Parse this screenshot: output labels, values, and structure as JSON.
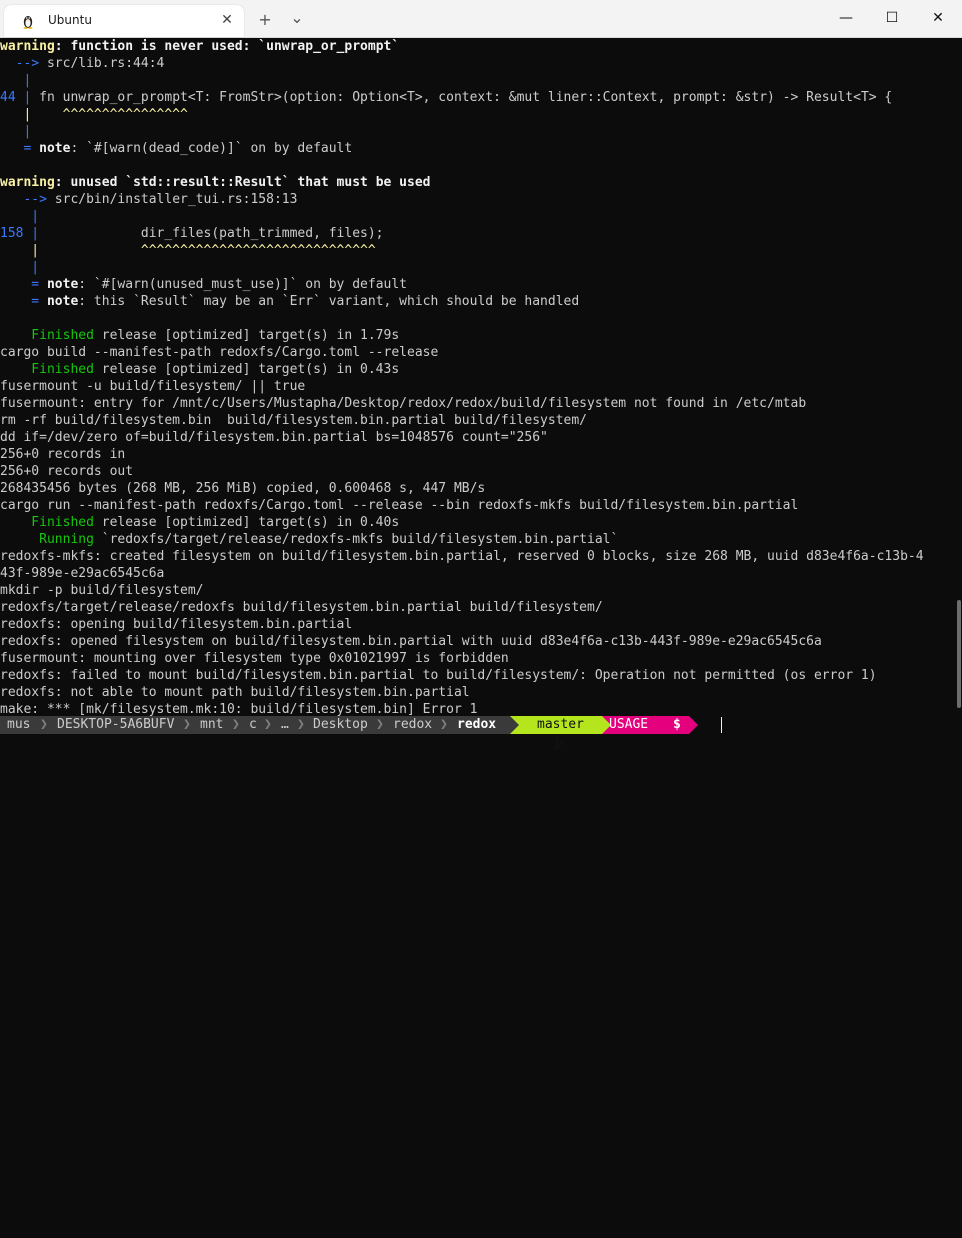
{
  "window": {
    "tab_title": "Ubuntu",
    "tab_icon": "linux-penguin-icon",
    "close_tab_glyph": "✕",
    "new_tab_glyph": "+",
    "dropdown_glyph": "⌄",
    "minimize_glyph": "—",
    "maximize_glyph": "☐",
    "close_glyph": "✕"
  },
  "colors": {
    "background": "#0c0c0c",
    "foreground": "#cccccc",
    "warning_yellow": "#f9f1a5",
    "blue": "#3b78ff",
    "green": "#16c60c",
    "prompt_grey": "#3a3a3a",
    "prompt_green": "#b5e61d",
    "prompt_magenta": "#e5007e"
  },
  "terminal": {
    "lines": [
      [
        {
          "t": "warning",
          "c": "c-warn"
        },
        {
          "t": ": function is never used: `unwrap_or_prompt`",
          "c": "c-white bold"
        }
      ],
      [
        {
          "t": "  --> ",
          "c": "c-blue"
        },
        {
          "t": "src/lib.rs:44:4",
          "c": "c-fg"
        }
      ],
      [
        {
          "t": "   |",
          "c": "c-blue"
        }
      ],
      [
        {
          "t": "44 |",
          "c": "c-blue"
        },
        {
          "t": " fn unwrap_or_prompt<T: FromStr>(option: Option<T>, context: &mut liner::Context, prompt: &str) -> Result<T> {",
          "c": "c-fg"
        }
      ],
      [
        {
          "t": "   |    ^^^^^^^^^^^^^^^^",
          "c": "c-yellow"
        }
      ],
      [
        {
          "t": "   |",
          "c": "c-blue"
        }
      ],
      [
        {
          "t": "   = ",
          "c": "c-blue"
        },
        {
          "t": "note",
          "c": "c-white bold"
        },
        {
          "t": ": `#[warn(dead_code)]` on by default",
          "c": "c-fg"
        }
      ],
      [
        {
          "t": "",
          "c": "c-fg"
        }
      ],
      [
        {
          "t": "warning",
          "c": "c-warn"
        },
        {
          "t": ": unused `std::result::Result` that must be used",
          "c": "c-white bold"
        }
      ],
      [
        {
          "t": "   --> ",
          "c": "c-blue"
        },
        {
          "t": "src/bin/installer_tui.rs:158:13",
          "c": "c-fg"
        }
      ],
      [
        {
          "t": "    |",
          "c": "c-blue"
        }
      ],
      [
        {
          "t": "158 |",
          "c": "c-blue"
        },
        {
          "t": "             dir_files(path_trimmed, files);",
          "c": "c-fg"
        }
      ],
      [
        {
          "t": "    |             ^^^^^^^^^^^^^^^^^^^^^^^^^^^^^^",
          "c": "c-yellow"
        }
      ],
      [
        {
          "t": "    |",
          "c": "c-blue"
        }
      ],
      [
        {
          "t": "    = ",
          "c": "c-blue"
        },
        {
          "t": "note",
          "c": "c-white bold"
        },
        {
          "t": ": `#[warn(unused_must_use)]` on by default",
          "c": "c-fg"
        }
      ],
      [
        {
          "t": "    = ",
          "c": "c-blue"
        },
        {
          "t": "note",
          "c": "c-white bold"
        },
        {
          "t": ": this `Result` may be an `Err` variant, which should be handled",
          "c": "c-fg"
        }
      ],
      [
        {
          "t": "",
          "c": "c-fg"
        }
      ],
      [
        {
          "t": "    Finished",
          "c": "c-green"
        },
        {
          "t": " release [optimized] target(s) in 1.79s",
          "c": "c-fg"
        }
      ],
      [
        {
          "t": "cargo build --manifest-path redoxfs/Cargo.toml --release",
          "c": "c-fg"
        }
      ],
      [
        {
          "t": "    Finished",
          "c": "c-green"
        },
        {
          "t": " release [optimized] target(s) in 0.43s",
          "c": "c-fg"
        }
      ],
      [
        {
          "t": "fusermount -u build/filesystem/ || true",
          "c": "c-fg"
        }
      ],
      [
        {
          "t": "fusermount: entry for /mnt/c/Users/Mustapha/Desktop/redox/redox/build/filesystem not found in /etc/mtab",
          "c": "c-fg"
        }
      ],
      [
        {
          "t": "rm -rf build/filesystem.bin  build/filesystem.bin.partial build/filesystem/",
          "c": "c-fg"
        }
      ],
      [
        {
          "t": "dd if=/dev/zero of=build/filesystem.bin.partial bs=1048576 count=\"256\"",
          "c": "c-fg"
        }
      ],
      [
        {
          "t": "256+0 records in",
          "c": "c-fg"
        }
      ],
      [
        {
          "t": "256+0 records out",
          "c": "c-fg"
        }
      ],
      [
        {
          "t": "268435456 bytes (268 MB, 256 MiB) copied, 0.600468 s, 447 MB/s",
          "c": "c-fg"
        }
      ],
      [
        {
          "t": "cargo run --manifest-path redoxfs/Cargo.toml --release --bin redoxfs-mkfs build/filesystem.bin.partial",
          "c": "c-fg"
        }
      ],
      [
        {
          "t": "    Finished",
          "c": "c-green"
        },
        {
          "t": " release [optimized] target(s) in 0.40s",
          "c": "c-fg"
        }
      ],
      [
        {
          "t": "     Running",
          "c": "c-green"
        },
        {
          "t": " `redoxfs/target/release/redoxfs-mkfs build/filesystem.bin.partial`",
          "c": "c-fg"
        }
      ],
      [
        {
          "t": "redoxfs-mkfs: created filesystem on build/filesystem.bin.partial, reserved 0 blocks, size 268 MB, uuid d83e4f6a-c13b-4",
          "c": "c-fg"
        }
      ],
      [
        {
          "t": "43f-989e-e29ac6545c6a",
          "c": "c-fg"
        }
      ],
      [
        {
          "t": "mkdir -p build/filesystem/",
          "c": "c-fg"
        }
      ],
      [
        {
          "t": "redoxfs/target/release/redoxfs build/filesystem.bin.partial build/filesystem/",
          "c": "c-fg"
        }
      ],
      [
        {
          "t": "redoxfs: opening build/filesystem.bin.partial",
          "c": "c-fg"
        }
      ],
      [
        {
          "t": "redoxfs: opened filesystem on build/filesystem.bin.partial with uuid d83e4f6a-c13b-443f-989e-e29ac6545c6a",
          "c": "c-fg"
        }
      ],
      [
        {
          "t": "fusermount: mounting over filesystem type 0x01021997 is forbidden",
          "c": "c-fg"
        }
      ],
      [
        {
          "t": "redoxfs: failed to mount build/filesystem.bin.partial to build/filesystem/: Operation not permitted (os error 1)",
          "c": "c-fg"
        }
      ],
      [
        {
          "t": "redoxfs: not able to mount path build/filesystem.bin.partial",
          "c": "c-fg"
        }
      ],
      [
        {
          "t": "make: *** [mk/filesystem.mk:10: build/filesystem.bin] Error 1",
          "c": "c-fg"
        }
      ]
    ]
  },
  "prompt": {
    "user": "mus",
    "host": "DESKTOP-5A6BUFV",
    "path": [
      "mnt",
      "c",
      "…",
      "Desktop",
      "redox",
      "redox"
    ],
    "branch_icon": "branch-icon",
    "branch": "master",
    "status": "USAGE",
    "symbol": "$"
  }
}
